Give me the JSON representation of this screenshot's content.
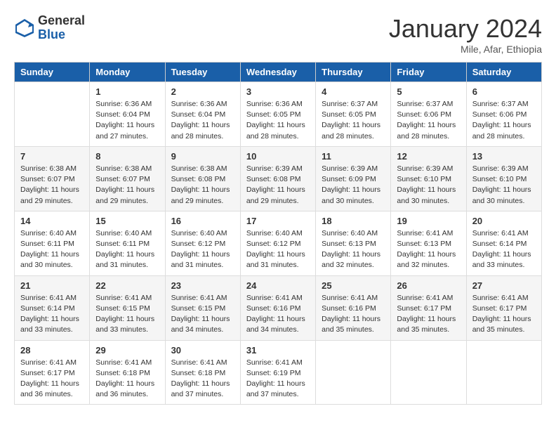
{
  "logo": {
    "general": "General",
    "blue": "Blue"
  },
  "title": "January 2024",
  "subtitle": "Mile, Afar, Ethiopia",
  "days_header": [
    "Sunday",
    "Monday",
    "Tuesday",
    "Wednesday",
    "Thursday",
    "Friday",
    "Saturday"
  ],
  "weeks": [
    [
      {
        "day": "",
        "sunrise": "",
        "sunset": "",
        "daylight": ""
      },
      {
        "day": "1",
        "sunrise": "Sunrise: 6:36 AM",
        "sunset": "Sunset: 6:04 PM",
        "daylight": "Daylight: 11 hours and 27 minutes."
      },
      {
        "day": "2",
        "sunrise": "Sunrise: 6:36 AM",
        "sunset": "Sunset: 6:04 PM",
        "daylight": "Daylight: 11 hours and 28 minutes."
      },
      {
        "day": "3",
        "sunrise": "Sunrise: 6:36 AM",
        "sunset": "Sunset: 6:05 PM",
        "daylight": "Daylight: 11 hours and 28 minutes."
      },
      {
        "day": "4",
        "sunrise": "Sunrise: 6:37 AM",
        "sunset": "Sunset: 6:05 PM",
        "daylight": "Daylight: 11 hours and 28 minutes."
      },
      {
        "day": "5",
        "sunrise": "Sunrise: 6:37 AM",
        "sunset": "Sunset: 6:06 PM",
        "daylight": "Daylight: 11 hours and 28 minutes."
      },
      {
        "day": "6",
        "sunrise": "Sunrise: 6:37 AM",
        "sunset": "Sunset: 6:06 PM",
        "daylight": "Daylight: 11 hours and 28 minutes."
      }
    ],
    [
      {
        "day": "7",
        "sunrise": "Sunrise: 6:38 AM",
        "sunset": "Sunset: 6:07 PM",
        "daylight": "Daylight: 11 hours and 29 minutes."
      },
      {
        "day": "8",
        "sunrise": "Sunrise: 6:38 AM",
        "sunset": "Sunset: 6:07 PM",
        "daylight": "Daylight: 11 hours and 29 minutes."
      },
      {
        "day": "9",
        "sunrise": "Sunrise: 6:38 AM",
        "sunset": "Sunset: 6:08 PM",
        "daylight": "Daylight: 11 hours and 29 minutes."
      },
      {
        "day": "10",
        "sunrise": "Sunrise: 6:39 AM",
        "sunset": "Sunset: 6:08 PM",
        "daylight": "Daylight: 11 hours and 29 minutes."
      },
      {
        "day": "11",
        "sunrise": "Sunrise: 6:39 AM",
        "sunset": "Sunset: 6:09 PM",
        "daylight": "Daylight: 11 hours and 30 minutes."
      },
      {
        "day": "12",
        "sunrise": "Sunrise: 6:39 AM",
        "sunset": "Sunset: 6:10 PM",
        "daylight": "Daylight: 11 hours and 30 minutes."
      },
      {
        "day": "13",
        "sunrise": "Sunrise: 6:39 AM",
        "sunset": "Sunset: 6:10 PM",
        "daylight": "Daylight: 11 hours and 30 minutes."
      }
    ],
    [
      {
        "day": "14",
        "sunrise": "Sunrise: 6:40 AM",
        "sunset": "Sunset: 6:11 PM",
        "daylight": "Daylight: 11 hours and 30 minutes."
      },
      {
        "day": "15",
        "sunrise": "Sunrise: 6:40 AM",
        "sunset": "Sunset: 6:11 PM",
        "daylight": "Daylight: 11 hours and 31 minutes."
      },
      {
        "day": "16",
        "sunrise": "Sunrise: 6:40 AM",
        "sunset": "Sunset: 6:12 PM",
        "daylight": "Daylight: 11 hours and 31 minutes."
      },
      {
        "day": "17",
        "sunrise": "Sunrise: 6:40 AM",
        "sunset": "Sunset: 6:12 PM",
        "daylight": "Daylight: 11 hours and 31 minutes."
      },
      {
        "day": "18",
        "sunrise": "Sunrise: 6:40 AM",
        "sunset": "Sunset: 6:13 PM",
        "daylight": "Daylight: 11 hours and 32 minutes."
      },
      {
        "day": "19",
        "sunrise": "Sunrise: 6:41 AM",
        "sunset": "Sunset: 6:13 PM",
        "daylight": "Daylight: 11 hours and 32 minutes."
      },
      {
        "day": "20",
        "sunrise": "Sunrise: 6:41 AM",
        "sunset": "Sunset: 6:14 PM",
        "daylight": "Daylight: 11 hours and 33 minutes."
      }
    ],
    [
      {
        "day": "21",
        "sunrise": "Sunrise: 6:41 AM",
        "sunset": "Sunset: 6:14 PM",
        "daylight": "Daylight: 11 hours and 33 minutes."
      },
      {
        "day": "22",
        "sunrise": "Sunrise: 6:41 AM",
        "sunset": "Sunset: 6:15 PM",
        "daylight": "Daylight: 11 hours and 33 minutes."
      },
      {
        "day": "23",
        "sunrise": "Sunrise: 6:41 AM",
        "sunset": "Sunset: 6:15 PM",
        "daylight": "Daylight: 11 hours and 34 minutes."
      },
      {
        "day": "24",
        "sunrise": "Sunrise: 6:41 AM",
        "sunset": "Sunset: 6:16 PM",
        "daylight": "Daylight: 11 hours and 34 minutes."
      },
      {
        "day": "25",
        "sunrise": "Sunrise: 6:41 AM",
        "sunset": "Sunset: 6:16 PM",
        "daylight": "Daylight: 11 hours and 35 minutes."
      },
      {
        "day": "26",
        "sunrise": "Sunrise: 6:41 AM",
        "sunset": "Sunset: 6:17 PM",
        "daylight": "Daylight: 11 hours and 35 minutes."
      },
      {
        "day": "27",
        "sunrise": "Sunrise: 6:41 AM",
        "sunset": "Sunset: 6:17 PM",
        "daylight": "Daylight: 11 hours and 35 minutes."
      }
    ],
    [
      {
        "day": "28",
        "sunrise": "Sunrise: 6:41 AM",
        "sunset": "Sunset: 6:17 PM",
        "daylight": "Daylight: 11 hours and 36 minutes."
      },
      {
        "day": "29",
        "sunrise": "Sunrise: 6:41 AM",
        "sunset": "Sunset: 6:18 PM",
        "daylight": "Daylight: 11 hours and 36 minutes."
      },
      {
        "day": "30",
        "sunrise": "Sunrise: 6:41 AM",
        "sunset": "Sunset: 6:18 PM",
        "daylight": "Daylight: 11 hours and 37 minutes."
      },
      {
        "day": "31",
        "sunrise": "Sunrise: 6:41 AM",
        "sunset": "Sunset: 6:19 PM",
        "daylight": "Daylight: 11 hours and 37 minutes."
      },
      {
        "day": "",
        "sunrise": "",
        "sunset": "",
        "daylight": ""
      },
      {
        "day": "",
        "sunrise": "",
        "sunset": "",
        "daylight": ""
      },
      {
        "day": "",
        "sunrise": "",
        "sunset": "",
        "daylight": ""
      }
    ]
  ]
}
